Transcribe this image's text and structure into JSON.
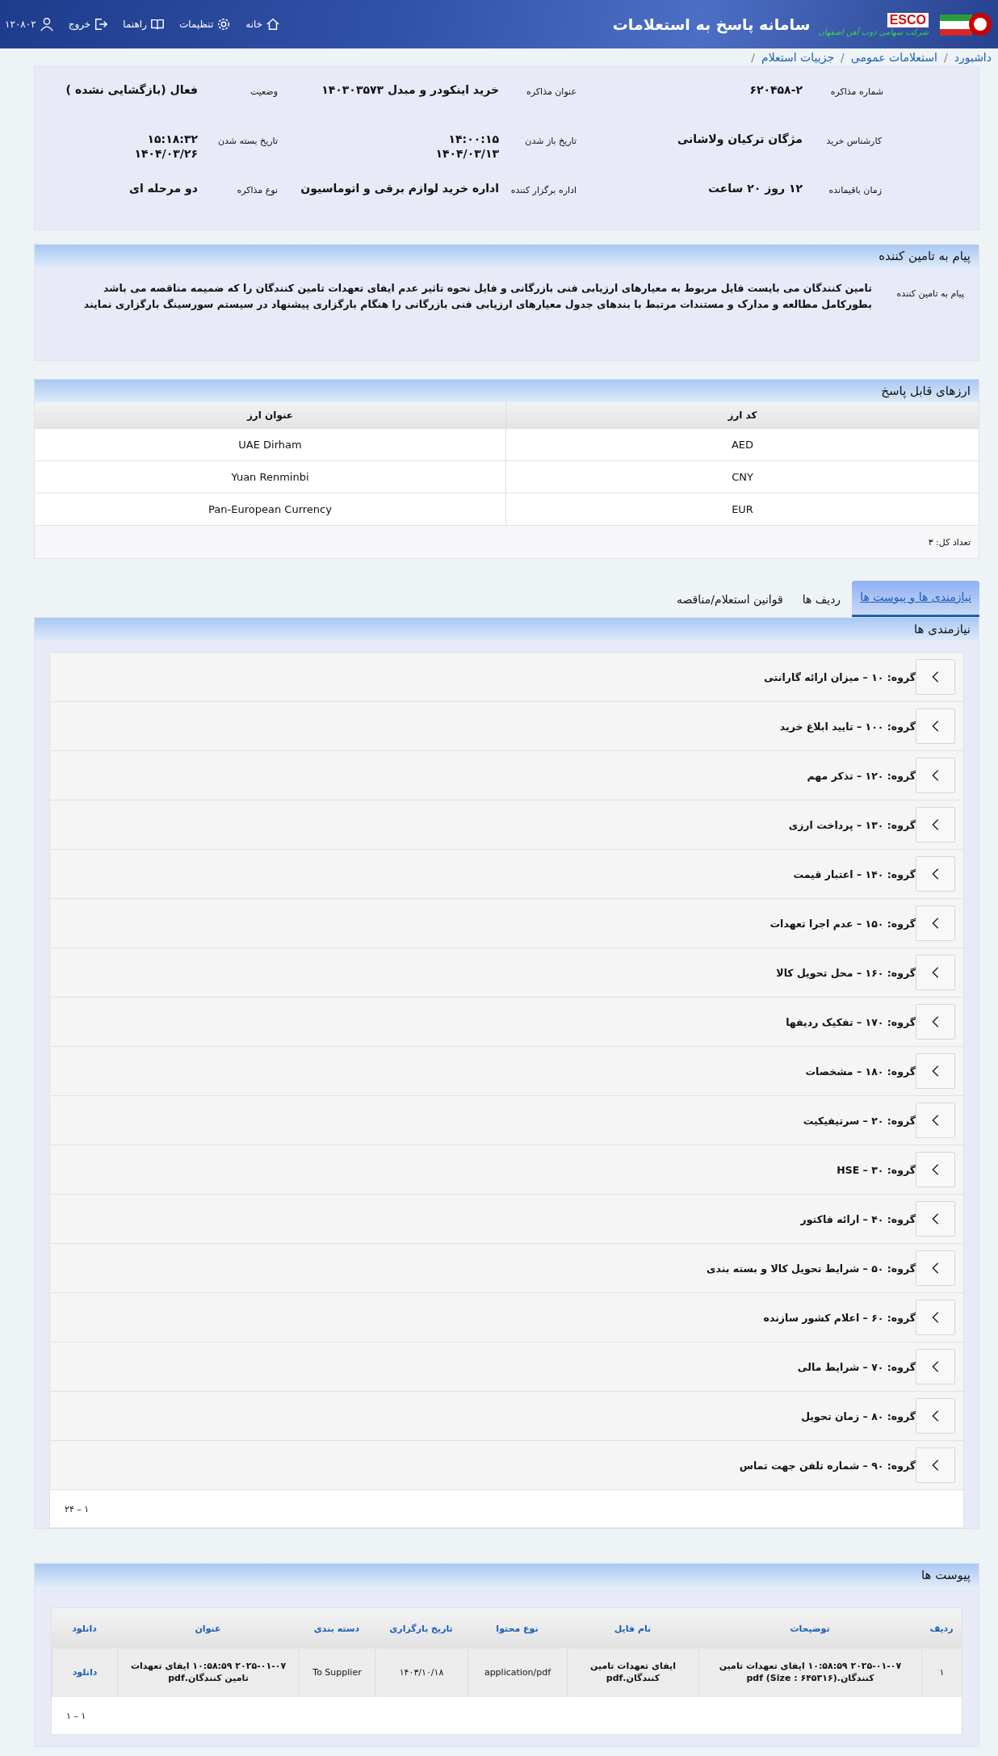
{
  "header": {
    "title": "سامانه پاسخ به استعلامات",
    "logo_text": "ESCO",
    "company": "شرکت سهامی ذوب آهن اصفهان",
    "nav": [
      {
        "label": "خانه",
        "kind": "home"
      },
      {
        "label": "تنظیمات",
        "kind": "settings"
      },
      {
        "label": "راهنما",
        "kind": "help"
      },
      {
        "label": "خروج",
        "kind": "logout"
      },
      {
        "label": "۱۲۰۸۰۲",
        "kind": "user"
      }
    ]
  },
  "breadcrumb": [
    {
      "label": "داشبورد",
      "separator": "/"
    },
    {
      "label": "استعلامات عمومی",
      "separator": "/"
    },
    {
      "label": "جزییات استعلام",
      "separator": "/"
    }
  ],
  "details": [
    {
      "label": "شماره مذاکره",
      "value": "۶۲۰۴۵۸-۲"
    },
    {
      "label": "عنوان مذاکره",
      "value": "خرید اینکودر و مبدل ۱۴۰۳۰۳۵۷۳"
    },
    {
      "label": "وضعیت",
      "value": "فعال (بازگشایی نشده )"
    },
    {
      "label": "کارشناس خرید",
      "value": "مژگان ترکیان ولاشانی"
    },
    {
      "label": "تاریخ باز شدن",
      "value": "۱۴:۰۰:۱۵\n۱۴۰۴/۰۳/۱۳"
    },
    {
      "label": "تاریخ بسته شدن",
      "value": "۱۵:۱۸:۳۲\n۱۴۰۴/۰۳/۲۶"
    },
    {
      "label": "زمان باقیمانده",
      "value": "۱۲ روز ۲۰ ساعت"
    },
    {
      "label": "اداره برگزار کننده",
      "value": "اداره خرید لوازم برقی و اتوماسیون"
    },
    {
      "label": "نوع مذاکره",
      "value": "دو مرحله ای"
    }
  ],
  "message": {
    "title": "پیام به تامین کننده",
    "label": "پیام به تامین کننده",
    "text": "تامین کنندگان می بایست فایل مربوط به معیارهای ارزیابی فنی بازرگانی و فایل نحوه تاثیر عدم ایفای تعهدات تامین کنندگان را که ضمیمه مناقصه می باشد بطورکامل مطالعه و مدارک و مستندات مرتبط با بندهای جدول معیارهای ارزیابی فنی بازرگانی را هنگام بارگزاری پیشنهاد در سیستم سورسینگ بارگزاری نمایند"
  },
  "currencies": {
    "title": "ارزهای قابل پاسخ",
    "columns": [
      "کد ارز",
      "عنوان ارز"
    ],
    "rows": [
      [
        "AED",
        "UAE Dirham"
      ],
      [
        "CNY",
        "Yuan Renminbi"
      ],
      [
        "EUR",
        "Pan-European Currency"
      ]
    ],
    "total": "تعداد کل: ۳"
  },
  "tabs": [
    {
      "label": "نیازمندی ها و پیوست ها",
      "selected": true
    },
    {
      "label": "ردیف ها",
      "selected": false
    },
    {
      "label": "قوانین استعلام/مناقصه",
      "selected": false
    }
  ],
  "requirements": {
    "title": "نیازمندی ها",
    "pager": "۱ – ۲۴",
    "groups": [
      {
        "label": "گروه: ۱۰ – میزان ارائه گارانتی",
        "expanded": false
      },
      {
        "label": "گروه: ۱۰۰ – تایید ابلاغ خرید",
        "expanded": false
      },
      {
        "label": "گروه: ۱۲۰ – تذکر مهم",
        "expanded": false
      },
      {
        "label": "گروه: ۱۳۰ – پرداخت ارزی",
        "expanded": false
      },
      {
        "label": "گروه: ۱۴۰ – اعتبار قیمت",
        "expanded": false
      },
      {
        "label": "گروه: ۱۵۰ – عدم اجرا تعهدات",
        "expanded": false
      },
      {
        "label": "گروه: ۱۶۰ – محل تحویل کالا",
        "expanded": false
      },
      {
        "label": "گروه: ۱۷۰ – تفکیک ردیفها",
        "expanded": false
      },
      {
        "label": "گروه: ۱۸۰ – مشخصات",
        "expanded": false
      },
      {
        "label": "گروه: ۲۰ – سرتیفیکیت",
        "expanded": false
      },
      {
        "label": "گروه: ۳۰ – HSE",
        "expanded": false
      },
      {
        "label": "گروه: ۴۰ – ارائه فاکتور",
        "expanded": false
      },
      {
        "label": "گروه: ۵۰ – شرایط تحویل کالا و بسته بندی",
        "expanded": false
      },
      {
        "label": "گروه: ۶۰ – اعلام کشور سازنده",
        "expanded": false
      },
      {
        "label": "گروه: ۷۰ – شرایط مالی",
        "expanded": false
      },
      {
        "label": "گروه: ۸۰ – زمان تحویل",
        "expanded": false
      },
      {
        "label": "گروه: ۹۰ – شماره تلفن جهت تماس",
        "expanded": false
      }
    ]
  },
  "attachments": {
    "title": "پیوست ها",
    "pager": "۱ – ۱",
    "columns": [
      "ردیف",
      "توضیحات",
      "نام فایل",
      "نوع محتوا",
      "تاریخ بارگزاری",
      "دسته بندی",
      "عنوان",
      "دانلود"
    ],
    "rows": [
      [
        "۱",
        "۲۰۲۵-۰۱-۰۷ ۱۰:۵۸:۵۹ ایفای تعهدات تامین کنندگان.(Size : ۶۴۵۳۱۶) pdf",
        "ایفای تعهدات تامین کنندگان.pdf",
        "application/pdf",
        "۱۴۰۳/۱۰/۱۸",
        "To Supplier",
        "۲۰۲۵-۰۱-۰۷ ۱۰:۵۸:۵۹ ایفای تعهدات تامین کنندگان.pdf",
        "دانلود"
      ]
    ]
  }
}
